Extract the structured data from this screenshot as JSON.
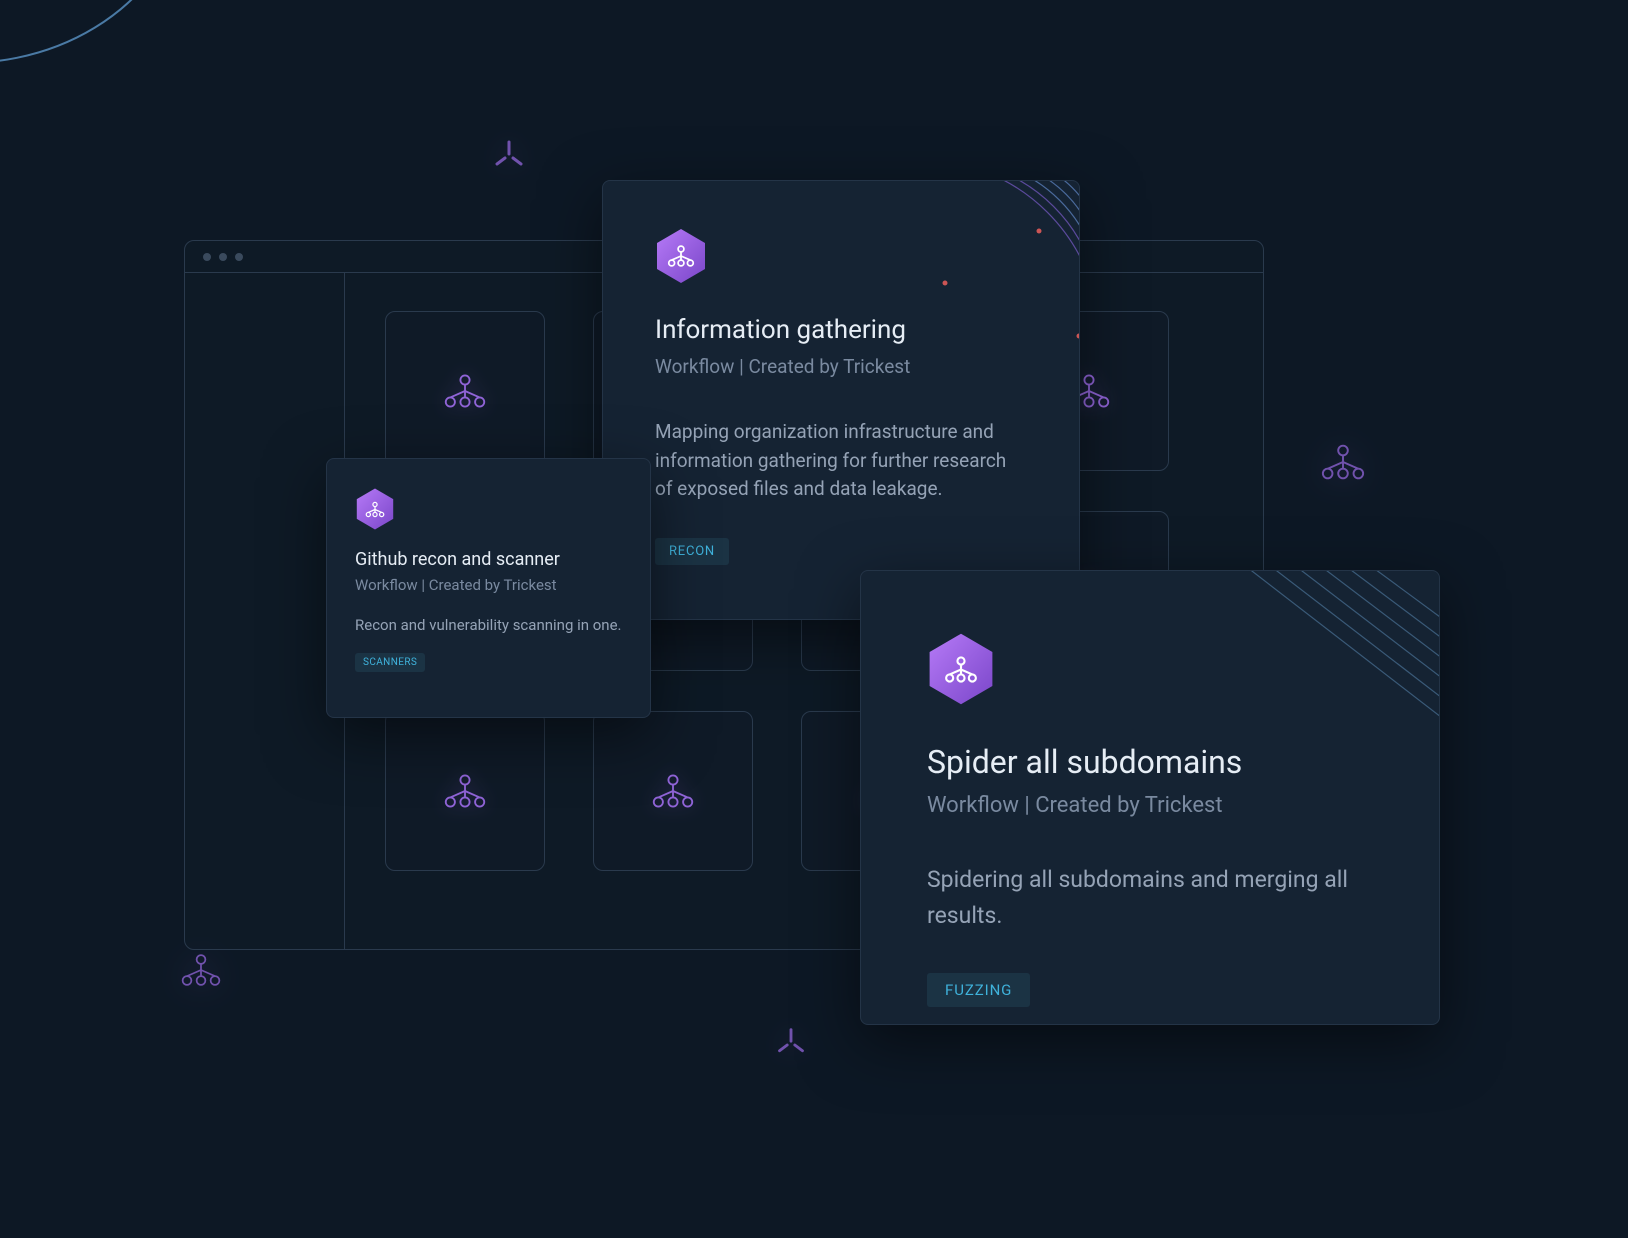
{
  "cards": {
    "github": {
      "title": "Github recon and scanner",
      "subtitle": "Workflow | Created by Trickest",
      "description": "Recon and vulnerability scanning in one.",
      "tag": "SCANNERS"
    },
    "info": {
      "title": "Information gathering",
      "subtitle": "Workflow | Created by Trickest",
      "description": "Mapping organization infrastructure and information gathering for further research of exposed files and data leakage.",
      "tag": "RECON"
    },
    "spider": {
      "title": "Spider all subdomains",
      "subtitle": "Workflow | Created by Trickest",
      "description": "Spidering all subdomains and merging all results.",
      "tag": "FUZZING"
    }
  },
  "colors": {
    "accent_purple": "#a771f6",
    "accent_gradient_dark": "#6b3fb8",
    "tag_bg": "#1b3344",
    "tag_text": "#3fb2db"
  }
}
